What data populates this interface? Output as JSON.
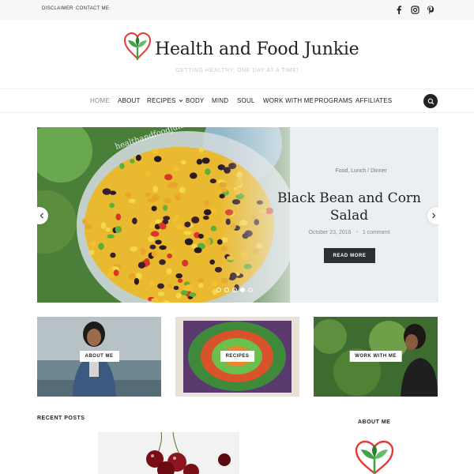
{
  "topbar": {
    "links": [
      "DISCLAIMER",
      "CONTACT ME"
    ],
    "social_icons": [
      "facebook-icon",
      "instagram-icon",
      "pinterest-icon"
    ]
  },
  "header": {
    "site_title": "Health and Food Junkie",
    "tagline": "GETTING HEALTHY, ONE DAY AT A TIME!"
  },
  "nav": {
    "items": [
      {
        "label": "HOME",
        "active": true
      },
      {
        "label": "ABOUT"
      },
      {
        "label": "RECIPES",
        "dropdown": true
      },
      {
        "label": "BODY"
      },
      {
        "label": "MIND"
      },
      {
        "label": "SOUL"
      },
      {
        "label": "WORK WITH ME"
      },
      {
        "label": "PROGRAMS"
      },
      {
        "label": "AFFILIATES"
      }
    ],
    "search_icon": "search-icon"
  },
  "slider": {
    "category": "Food, Lunch / Dinner",
    "title": "Black Bean and Corn Salad",
    "date": "October 23, 2016",
    "separator": "•",
    "comments": "1 comment",
    "read_more": "READ MORE",
    "watermark": "healthandfoodjunkie",
    "slide_count": 5,
    "active_slide": 4
  },
  "promos": [
    {
      "label": "ABOUT ME"
    },
    {
      "label": "RECIPES"
    },
    {
      "label": "WORK WITH ME"
    }
  ],
  "main": {
    "recent_posts_heading": "RECENT POSTS"
  },
  "sidebar": {
    "about_heading": "ABOUT ME"
  },
  "colors": {
    "accent_dark": "#2c2f33",
    "logo_green": "#4caf50",
    "logo_red": "#e53935",
    "slider_bg": "#eceff1"
  }
}
